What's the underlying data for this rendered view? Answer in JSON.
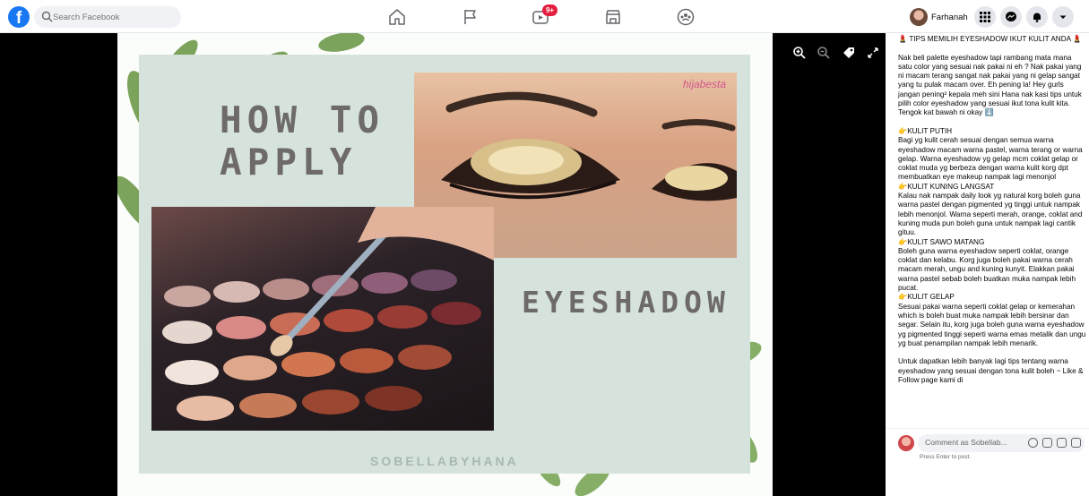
{
  "header": {
    "logo": "f",
    "search_placeholder": "Search Facebook",
    "nav": [
      "home-icon",
      "pages-icon",
      "watch-icon",
      "marketplace-icon",
      "groups-icon"
    ],
    "watch_badge": "9+",
    "profile_name": "Farhanah",
    "right_icons": [
      "menu-grid-icon",
      "messenger-icon",
      "notifications-icon",
      "account-dropdown-icon"
    ],
    "accent": "#1877f2",
    "badge_color": "#e41e3f"
  },
  "photo": {
    "headline_line1": "HOW TO",
    "headline_line2": "APPLY",
    "headline_line3": "EYESHADOW",
    "brand": "SOBELLABYHANA",
    "watermark": "hijabesta",
    "viewer_tools": [
      "zoom-in-icon",
      "zoom-out-icon",
      "tag-icon",
      "fullscreen-icon"
    ]
  },
  "post": {
    "title": "💄 TIPS MEMILIH EYESHADOW IKUT KULIT ANDA 💄",
    "paragraphs": [
      "Nak beli palette eyeshadow tapi rambang mata mana satu color yang sesuai nak pakai ni eh ? Nak pakai yang ni macam terang sangat nak pakai yang ni gelap sangat yang tu pulak macam over. Eh pening la! Hey gurls jangan pening² kepala meh sini Hana nak kasi tips untuk pilih color eyeshadow yang sesuai ikut tona kulit kita. Tengok kat bawah ni okay ⬇️",
      "👉KULIT PUTIH\nBagi yg kulit cerah sesuai dengan semua warna eyeshadow macam warna pastel, warna terang or warna gelap. Warna eyeshadow yg gelap mcm coklat gelap or coklat muda yg berbeza dengan warna kulit korg dpt membuatkan eye makeup nampak lagi menonjol\n👉KULIT KUNING LANGSAT\nKalau nak nampak daily look yg natural korg boleh guna warna pastel dengan pigmented yg tinggi untuk nampak lebih menonjol. Warna seperti merah, orange, coklat and kuning muda pun boleh guna untuk nampak lagi cantik gituu.\n👉KULIT SAWO MATANG\nBoleh guna warna eyeshadow seperti coklat, orange coklat dan kelabu. Korg juga boleh pakai warna cerah macam merah, ungu and kuning kunyit. Elakkan pakai warna pastel sebab boleh buatkan muka nampak lebih pucat.\n👉KULIT GELAP\nSesuai pakai warna seperti coklat gelap or kemerahan which is boleh buat muka nampak lebih bersinar dan segar. Selain itu, korg juga boleh guna warna eyeshadow yg pigmented tinggi seperti warna emas metalik dan ungu yg buat penampilan nampak lebih menarik.",
      "Untuk dapatkan lebih banyak lagi tips tentang warna eyeshadow yang sesuai dengan tona kulit boleh ~ Like & Follow page kami di"
    ]
  },
  "comment": {
    "placeholder": "Comment as Sobellab...",
    "hint": "Press Enter to post.",
    "icons": [
      "emoji-icon",
      "camera-icon",
      "gif-icon",
      "sticker-icon"
    ]
  }
}
